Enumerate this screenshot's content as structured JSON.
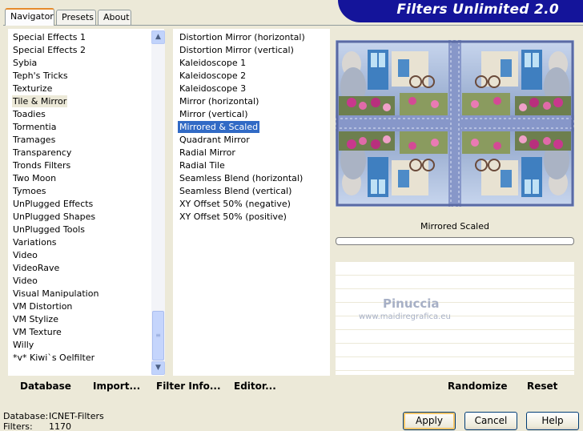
{
  "app": {
    "title": "Filters Unlimited 2.0"
  },
  "tabs": [
    {
      "label": "Navigator",
      "active": true
    },
    {
      "label": "Presets",
      "active": false
    },
    {
      "label": "About",
      "active": false
    }
  ],
  "categories": {
    "items": [
      "Special Effects 1",
      "Special Effects 2",
      "Sybia",
      "Teph's Tricks",
      "Texturize",
      "Tile & Mirror",
      "Toadies",
      "Tormentia",
      "Tramages",
      "Transparency",
      "Tronds Filters",
      "Two Moon",
      "Tymoes",
      "UnPlugged Effects",
      "UnPlugged Shapes",
      "UnPlugged Tools",
      "Variations",
      "Video",
      "VideoRave",
      "Video",
      "Visual Manipulation",
      "VM Distortion",
      "VM Stylize",
      "VM Texture",
      "Willy",
      "*v* Kiwi`s Oelfilter"
    ],
    "selected_index": 5
  },
  "filters": {
    "items": [
      "Distortion Mirror (horizontal)",
      "Distortion Mirror (vertical)",
      "Kaleidoscope 1",
      "Kaleidoscope 2",
      "Kaleidoscope 3",
      "Mirror (horizontal)",
      "Mirror (vertical)",
      "Mirrored & Scaled",
      "Quadrant Mirror",
      "Radial Mirror",
      "Radial Tile",
      "Seamless Blend (horizontal)",
      "Seamless Blend (vertical)",
      "XY Offset 50% (negative)",
      "XY Offset 50% (positive)"
    ],
    "selected_index": 7
  },
  "preview": {
    "filter_name": "Mirrored  Scaled",
    "watermark_name": "Pinuccia",
    "watermark_url": "www.maidiregrafica.eu"
  },
  "toolbar": {
    "database": "Database",
    "import": "Import...",
    "filter_info": "Filter Info...",
    "editor": "Editor...",
    "randomize": "Randomize",
    "reset": "Reset"
  },
  "footer": {
    "database_label": "Database:",
    "database_value": "ICNET-Filters",
    "filters_label": "Filters:",
    "filters_value": "1170",
    "apply": "Apply",
    "cancel": "Cancel",
    "help": "Help"
  },
  "icons": {
    "scroll_up": "chevron-up-icon",
    "scroll_down": "chevron-down-icon",
    "scroll_grip": "grip-icon"
  },
  "colors": {
    "banner": "#14149a",
    "selection": "#316ac5",
    "background": "#ece9d8"
  }
}
